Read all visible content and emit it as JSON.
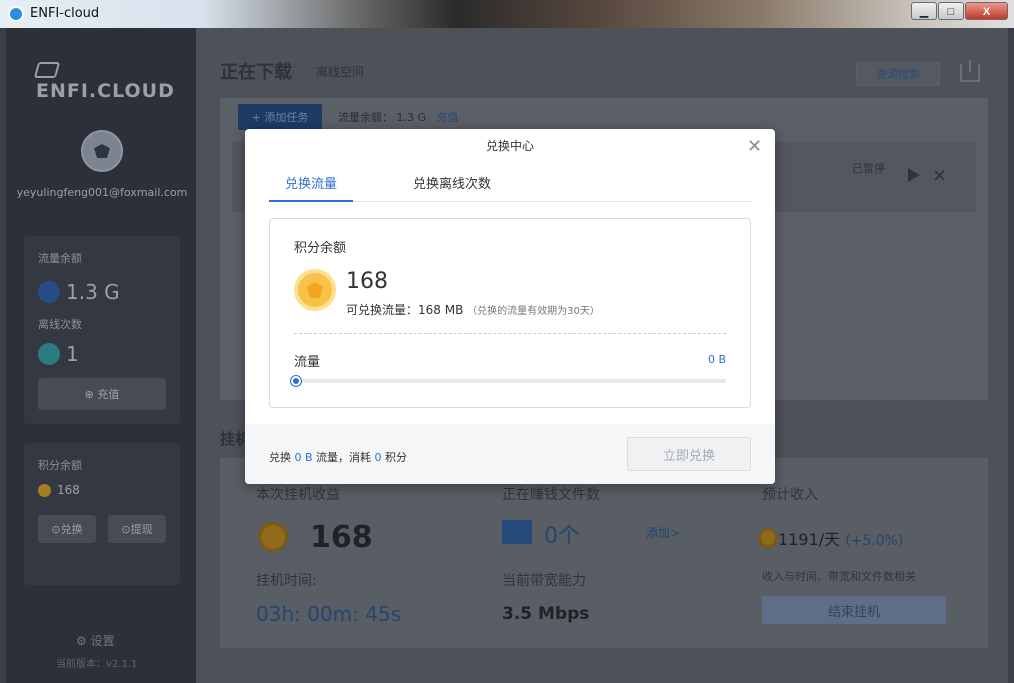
{
  "window": {
    "title": "ENFI-cloud",
    "min": "▁",
    "max": "□",
    "close": "X"
  },
  "sidebar": {
    "logo": "ENFI.CLOUD",
    "email": "yeyulingfeng001@foxmail.com",
    "traffic_label": "流量余额",
    "traffic_value": "1.3 G",
    "offline_label": "离线次数",
    "offline_value": "1",
    "recharge": "⊕ 充值",
    "points_label": "积分余额",
    "points_value": "168",
    "exchange": "⊙兑换",
    "withdraw": "⊙提现",
    "settings": "⚙ 设置",
    "version": "当前版本：v2.1.1"
  },
  "main": {
    "title": "正在下载",
    "tab_offline": "离线空间",
    "resource_search": "资源搜索",
    "add_task": "+ 添加任务",
    "traffic_text": "流量余额：",
    "traffic_value": "1.3 G",
    "recharge_link": "充值",
    "paused": "已暂停",
    "hang_title": "挂机"
  },
  "stats": {
    "earnings_label": "本次挂机收益",
    "earnings_value": "168",
    "time_label": "挂机时间:",
    "time_value": "03h: 00m: 45s",
    "files_label": "正在赚钱文件数",
    "files_value": "0个",
    "add_link": "添加>",
    "bandwidth_label": "当前带宽能力",
    "bandwidth_value": "3.5 Mbps",
    "income_label": "预计收入",
    "income_value": "1191/天",
    "income_pct": "(+5.0%)",
    "income_note": "收入与时间、带宽和文件数相关",
    "end_button": "结束挂机"
  },
  "modal": {
    "title": "兑换中心",
    "tab_traffic": "兑换流量",
    "tab_offline": "兑换离线次数",
    "points_title": "积分余额",
    "points_value": "168",
    "exchangeable": "可兑换流量：168 MB",
    "exchangeable_note": "（兑换的流量有效期为30天）",
    "flow_label": "流量",
    "flow_value": "0 B",
    "slider_fraction": 0,
    "foot_prefix": "兑换 ",
    "foot_amount": "0 B",
    "foot_mid": " 流量，消耗 ",
    "foot_points": "0",
    "foot_suffix": " 积分",
    "redeem_button": "立即兑换"
  },
  "colors": {
    "accent": "#2e6fd3",
    "coin": "#f7c24a"
  }
}
